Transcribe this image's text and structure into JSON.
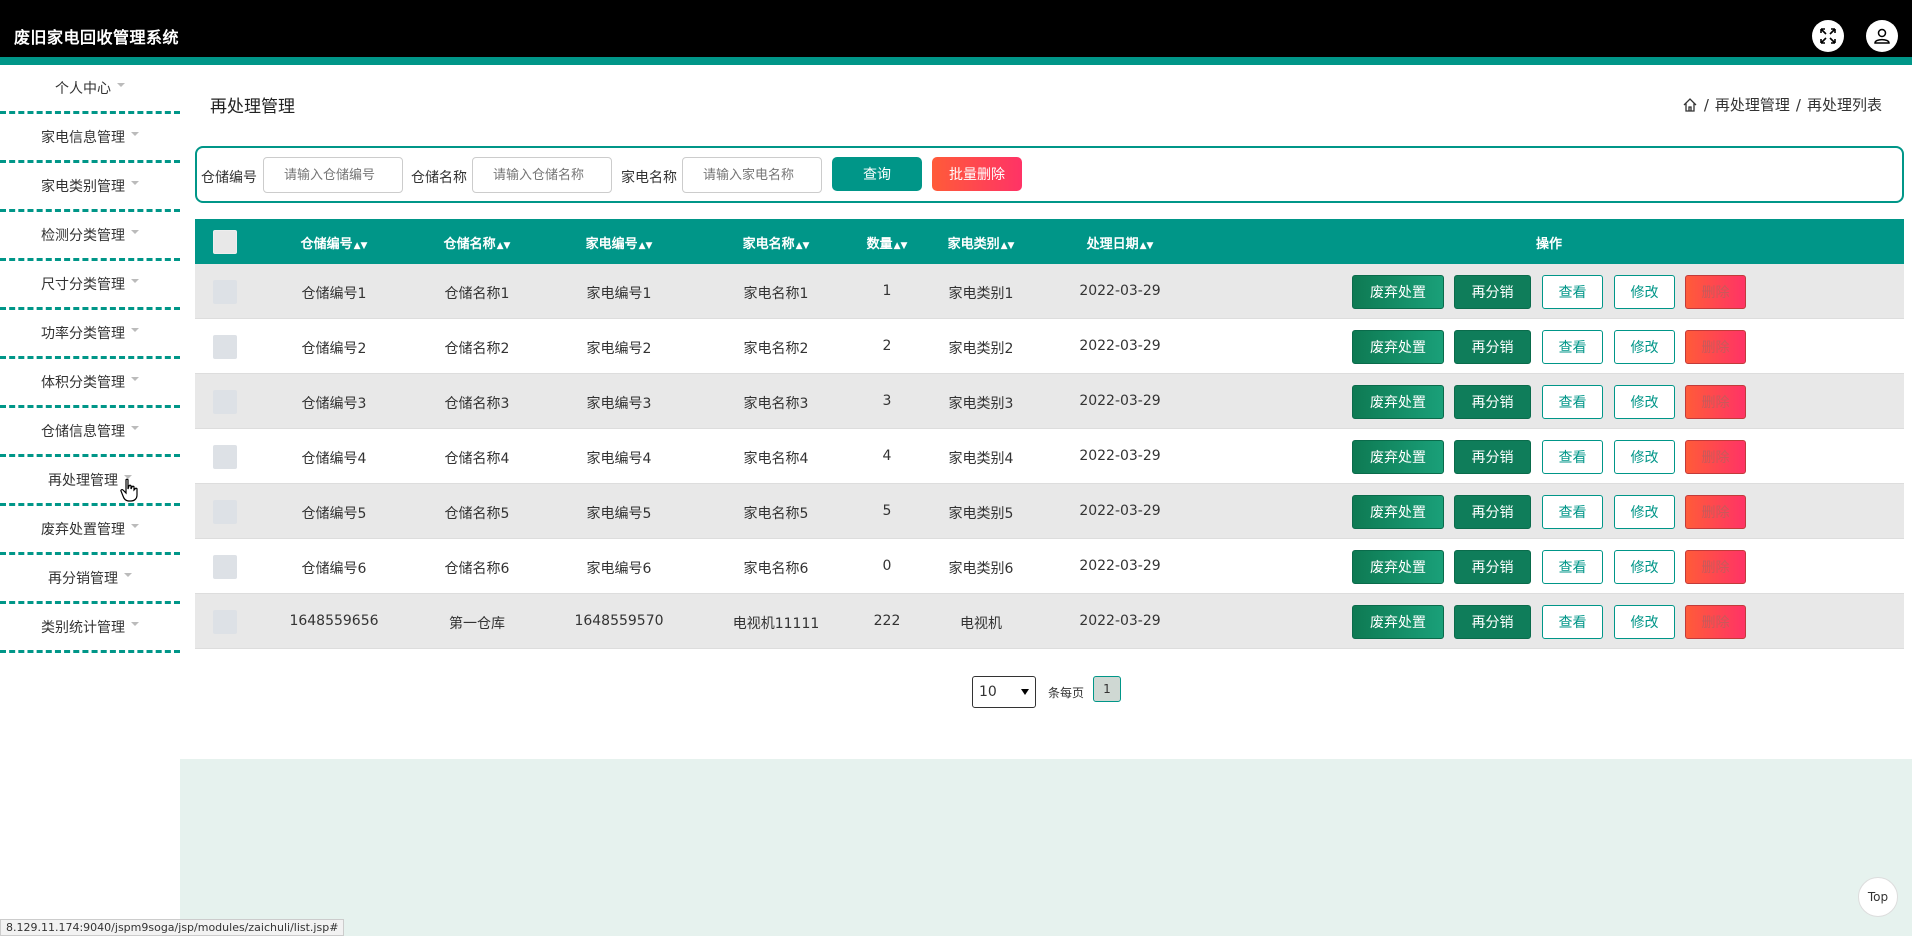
{
  "app": {
    "title": "废旧家电回收管理系统"
  },
  "sidebar": {
    "items": [
      {
        "label": "个人中心"
      },
      {
        "label": "家电信息管理"
      },
      {
        "label": "家电类别管理"
      },
      {
        "label": "检测分类管理"
      },
      {
        "label": "尺寸分类管理"
      },
      {
        "label": "功率分类管理"
      },
      {
        "label": "体积分类管理"
      },
      {
        "label": "仓储信息管理"
      },
      {
        "label": "再处理管理"
      },
      {
        "label": "废弃处置管理"
      },
      {
        "label": "再分销管理"
      },
      {
        "label": "类别统计管理"
      }
    ]
  },
  "page": {
    "heading": "再处理管理",
    "breadcrumb": [
      "再处理管理",
      "再处理列表"
    ],
    "breadcrumb_sep": "/"
  },
  "search": {
    "label1": "仓储编号",
    "placeholder1": "请输入仓储编号",
    "label2": "仓储名称",
    "placeholder2": "请输入仓储名称",
    "label3": "家电名称",
    "placeholder3": "请输入家电名称",
    "query_label": "查询",
    "batch_delete_label": "批量删除"
  },
  "table": {
    "columns": [
      "仓储编号",
      "仓储名称",
      "家电编号",
      "家电名称",
      "数量",
      "家电类别",
      "处理日期",
      "操作"
    ],
    "rows": [
      [
        "仓储编号1",
        "仓储名称1",
        "家电编号1",
        "家电名称1",
        "1",
        "家电类别1",
        "2022-03-29"
      ],
      [
        "仓储编号2",
        "仓储名称2",
        "家电编号2",
        "家电名称2",
        "2",
        "家电类别2",
        "2022-03-29"
      ],
      [
        "仓储编号3",
        "仓储名称3",
        "家电编号3",
        "家电名称3",
        "3",
        "家电类别3",
        "2022-03-29"
      ],
      [
        "仓储编号4",
        "仓储名称4",
        "家电编号4",
        "家电名称4",
        "4",
        "家电类别4",
        "2022-03-29"
      ],
      [
        "仓储编号5",
        "仓储名称5",
        "家电编号5",
        "家电名称5",
        "5",
        "家电类别5",
        "2022-03-29"
      ],
      [
        "仓储编号6",
        "仓储名称6",
        "家电编号6",
        "家电名称6",
        "0",
        "家电类别6",
        "2022-03-29"
      ],
      [
        "1648559656",
        "第一仓库",
        "1648559570",
        "电视机11111",
        "222",
        "电视机",
        "2022-03-29"
      ]
    ],
    "actions": {
      "discard": "废弃处置",
      "redistribute": "再分销",
      "view": "查看",
      "edit": "修改",
      "delete": "删除"
    }
  },
  "pager": {
    "page_size": "10",
    "per_page_label": "条每页",
    "current_page": "1"
  },
  "status_url": "8.129.11.174:9040/jspm9soga/jsp/modules/zaichuli/list.jsp#",
  "top_button": "Top",
  "colors": {
    "accent": "#009688",
    "danger": "#ff3366",
    "action_green": "#0f7d5a"
  }
}
